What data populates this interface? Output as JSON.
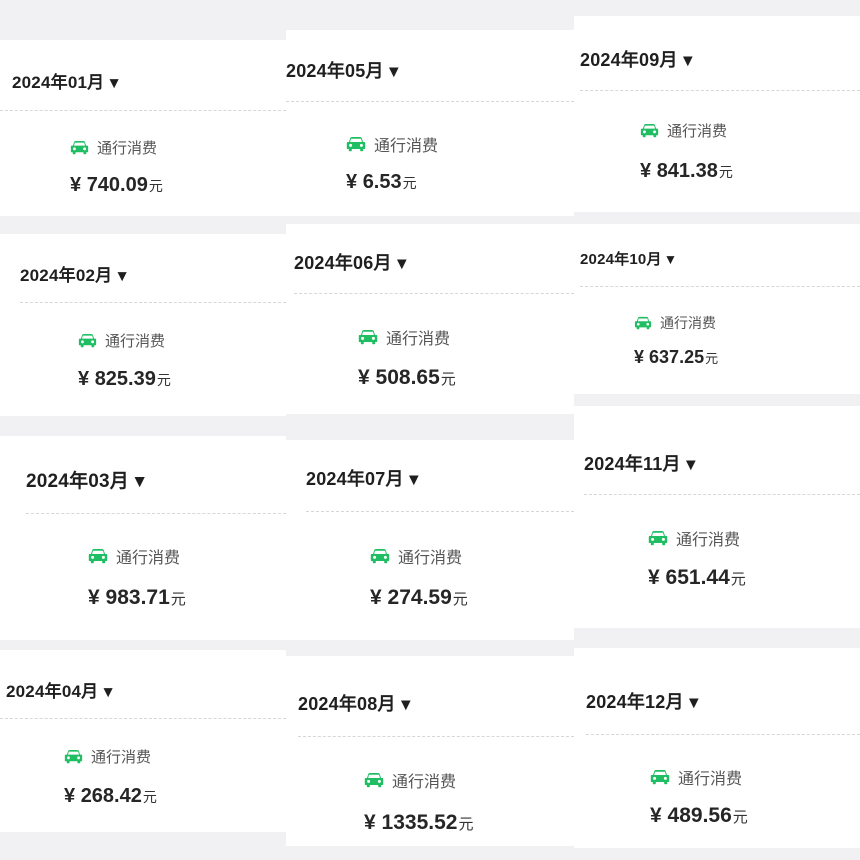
{
  "colors": {
    "accent": "#1fbe63",
    "background": "#f1f1f3",
    "card": "#ffffff"
  },
  "icons": {
    "car": "car-icon",
    "dropdown": "caret-down-icon"
  },
  "common": {
    "category_label": "通行消费",
    "currency_symbol": "¥",
    "unit": "元",
    "caret": "▼"
  },
  "months": [
    {
      "label": "2024年01月",
      "amount": "740.09"
    },
    {
      "label": "2024年02月",
      "amount": "825.39"
    },
    {
      "label": "2024年03月",
      "amount": "983.71"
    },
    {
      "label": "2024年04月",
      "amount": "268.42"
    },
    {
      "label": "2024年05月",
      "amount": "6.53"
    },
    {
      "label": "2024年06月",
      "amount": "508.65"
    },
    {
      "label": "2024年07月",
      "amount": "274.59"
    },
    {
      "label": "2024年08月",
      "amount": "1335.52"
    },
    {
      "label": "2024年09月",
      "amount": "841.38"
    },
    {
      "label": "2024年10月",
      "amount": "637.25"
    },
    {
      "label": "2024年11月",
      "amount": "651.44"
    },
    {
      "label": "2024年12月",
      "amount": "489.56"
    }
  ]
}
